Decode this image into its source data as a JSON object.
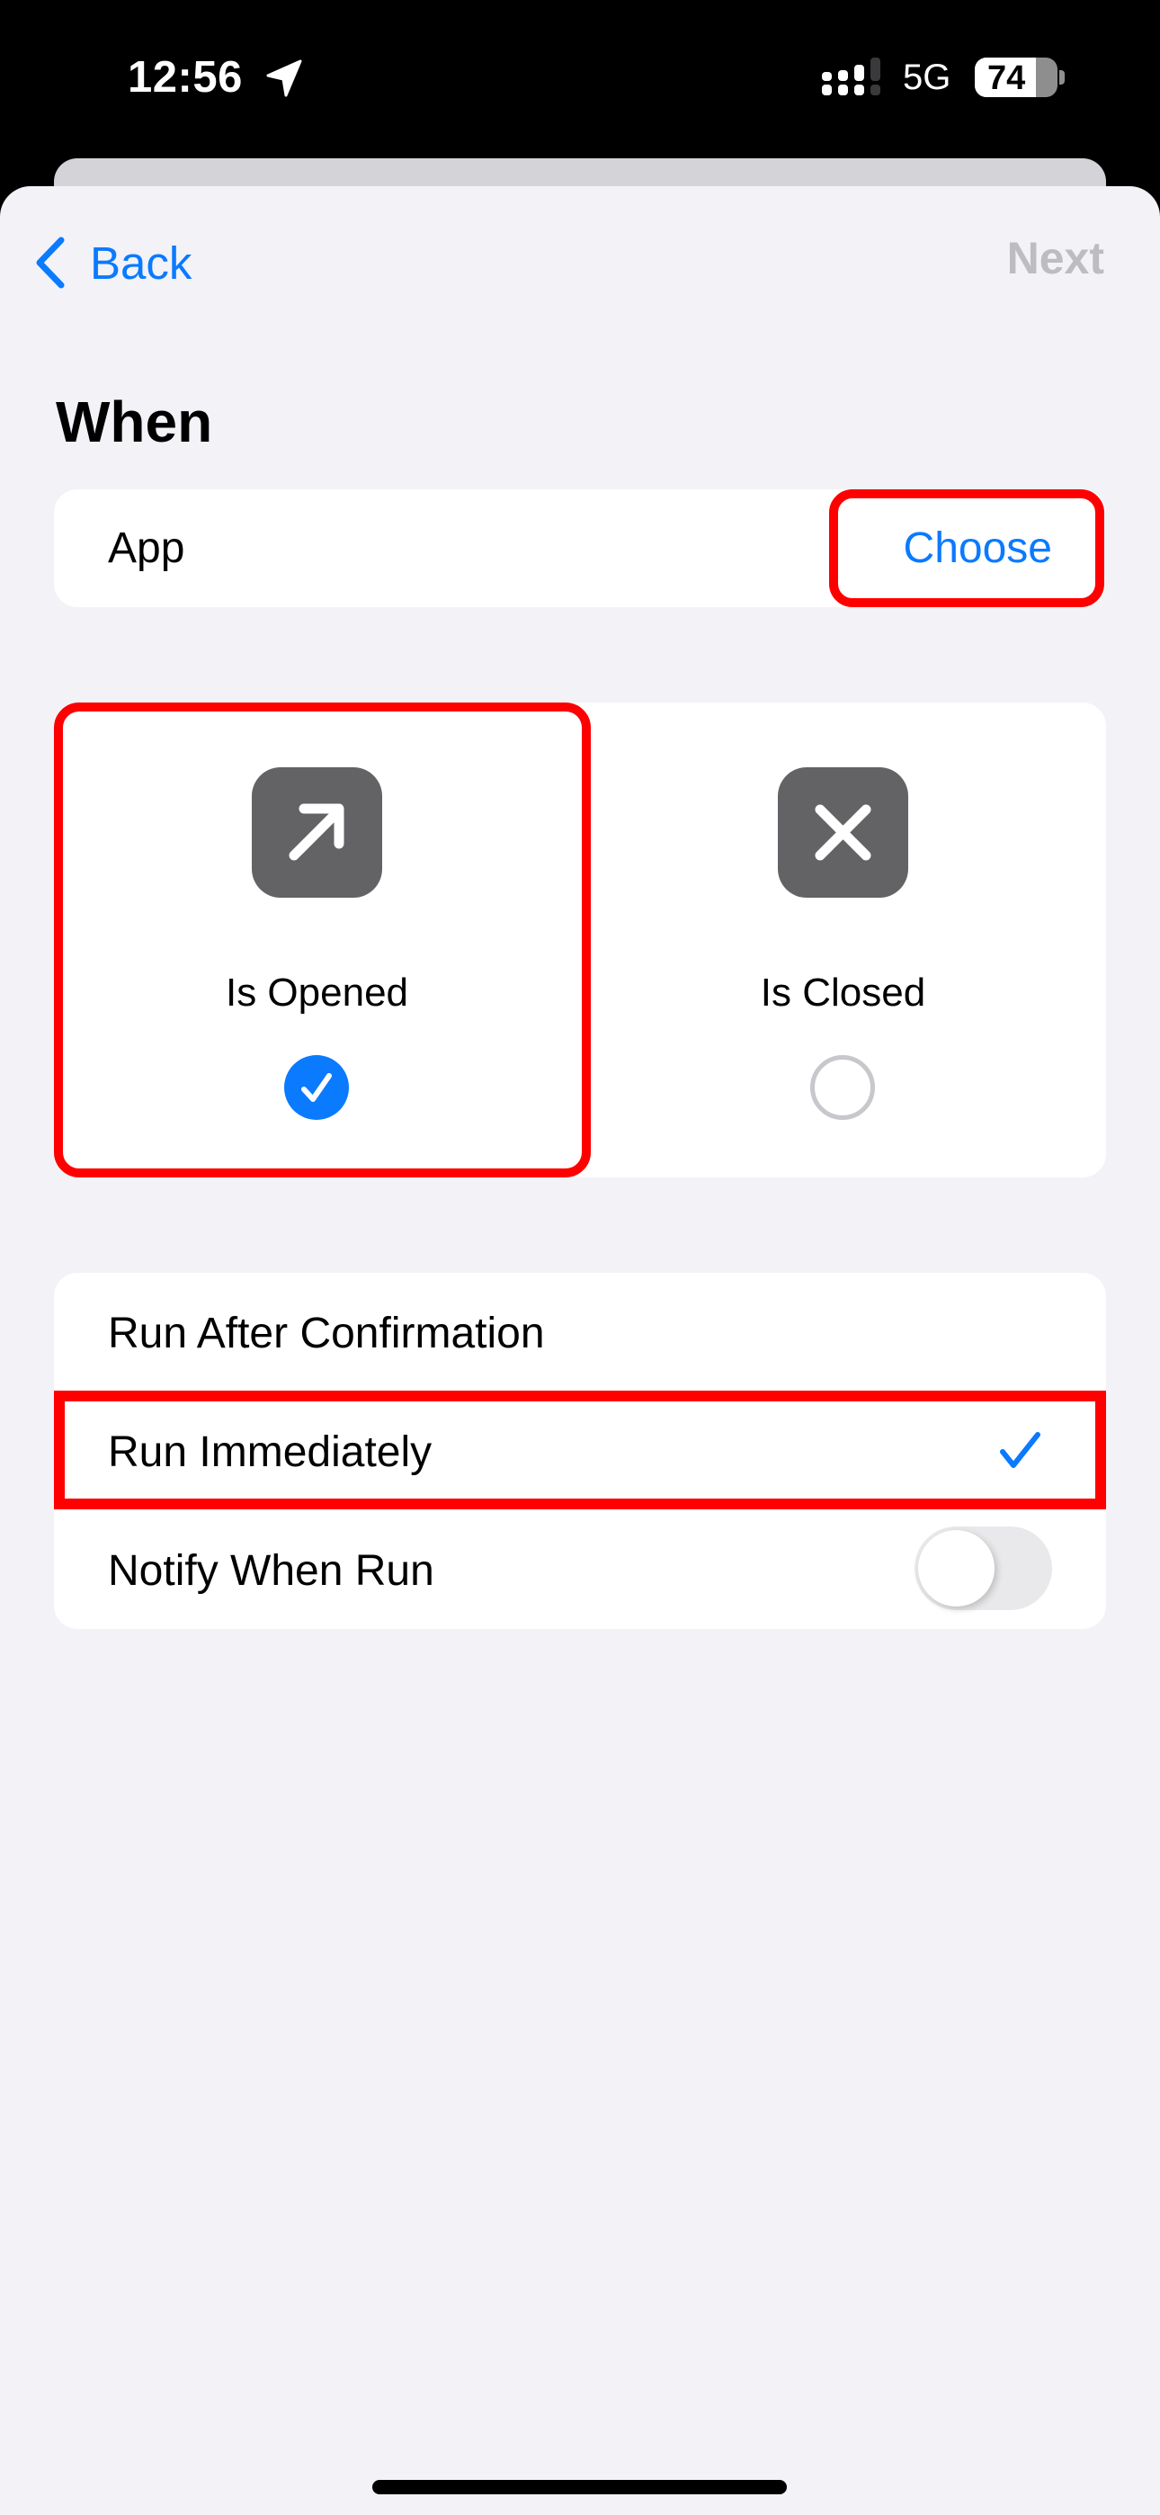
{
  "status_bar": {
    "time": "12:56",
    "location_icon": "location-arrow-icon",
    "signal_icon": "cellular-signal-icon",
    "network": "5G",
    "battery_percent": 74,
    "battery_label": "74"
  },
  "nav": {
    "back_label": "Back",
    "back_icon": "chevron-left-icon",
    "next_label": "Next",
    "next_enabled": false
  },
  "section": {
    "title": "When"
  },
  "app_row": {
    "label": "App",
    "action_label": "Choose"
  },
  "app_state": {
    "options": [
      {
        "label": "Is Opened",
        "icon": "arrow-up-right-icon",
        "selected": true
      },
      {
        "label": "Is Closed",
        "icon": "xmark-icon",
        "selected": false
      }
    ]
  },
  "run_options": {
    "items": [
      {
        "label": "Run After Confirmation",
        "selected": false
      },
      {
        "label": "Run Immediately",
        "selected": true
      },
      {
        "label": "Notify When Run",
        "type": "toggle",
        "on": false
      }
    ]
  },
  "colors": {
    "accent": "#0a7aff",
    "background": "#f2f2f7",
    "card": "#ffffff",
    "disabled_text": "#bdbdc1",
    "icon_tile": "#636366",
    "highlight": "#ff0000"
  },
  "annotations": {
    "highlighted_elements": [
      "Choose",
      "Is Opened",
      "Run Immediately"
    ]
  }
}
